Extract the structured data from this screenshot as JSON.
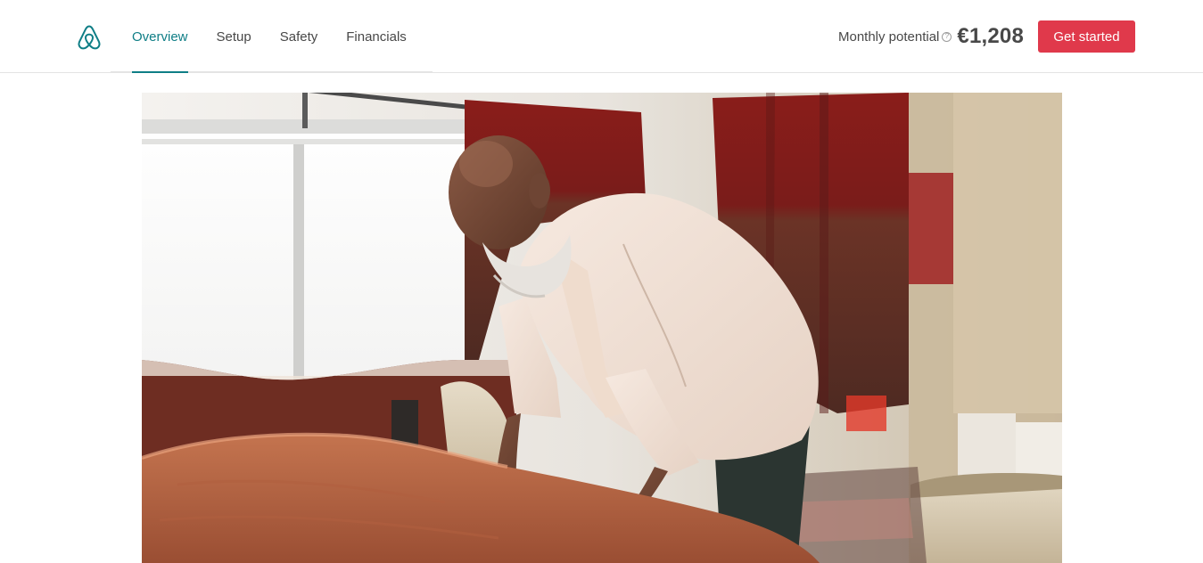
{
  "header": {
    "logo_icon": "airbnb-belo-icon",
    "tabs": [
      {
        "label": "Overview",
        "active": true
      },
      {
        "label": "Setup",
        "active": false
      },
      {
        "label": "Safety",
        "active": false
      },
      {
        "label": "Financials",
        "active": false
      }
    ],
    "potential": {
      "label": "Monthly potential",
      "help_icon": "question-circle-icon",
      "help_glyph": "?",
      "value": "€1,208"
    },
    "cta_label": "Get started"
  },
  "hero": {
    "image": "host-making-bed-photo"
  },
  "colors": {
    "accent": "#0f7e86",
    "cta": "#e0394b",
    "text": "#484848"
  }
}
